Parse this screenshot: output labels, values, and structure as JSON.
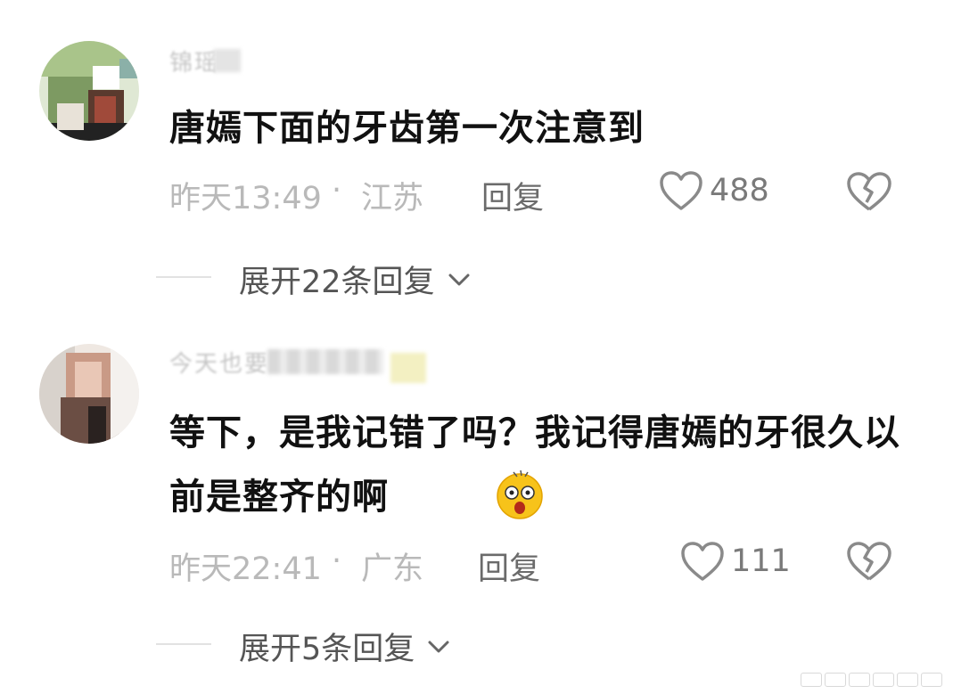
{
  "comments": [
    {
      "username": "锦瑶",
      "text": "唐嫣下面的牙齿第一次注意到",
      "time": "昨天13:49",
      "location": "江苏",
      "separator": "·",
      "reply_label": "回复",
      "likes": "488",
      "expand_label": "展开22条回复"
    },
    {
      "username": "今天也要",
      "text": "等下，是我记错了吗？我记得唐嫣的牙很久以前是整齐的啊",
      "time": "昨天22:41",
      "location": "广东",
      "separator": "·",
      "reply_label": "回复",
      "likes": "111",
      "expand_label": "展开5条回复"
    }
  ],
  "icons": {
    "like": "heart-outline-icon",
    "dislike": "broken-heart-icon",
    "expand": "chevron-down-icon",
    "emoji": "shocked-face-emoji"
  },
  "colors": {
    "text": "#111111",
    "meta": "#b9b9b9",
    "reply": "#6b6b6b",
    "icon": "#8a8a8a"
  }
}
